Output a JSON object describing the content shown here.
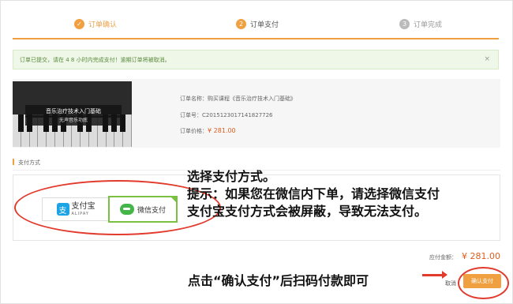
{
  "steps": [
    {
      "num": "✓",
      "label": "订单确认"
    },
    {
      "num": "2",
      "label": "订单支付"
    },
    {
      "num": "3",
      "label": "订单完成"
    }
  ],
  "alert": {
    "text": "订单已提交，请在 4 8 小时内完成支付！逾期订单将被取消。",
    "close": "×"
  },
  "order": {
    "course_title": "音乐治疗技术入门基础",
    "course_subtitle": "无声音乐功底",
    "name": "订单名称：购买课程《音乐治疗技术入门基础》",
    "number": "订单号：C2015123017141827726",
    "price_label": "订单价格：",
    "price": "¥ 281.00"
  },
  "payment": {
    "section_label": "支付方式",
    "alipay_name": "支付宝",
    "alipay_sub": "ALIPAY",
    "wechat_name": "微信支付"
  },
  "notes": {
    "line1": "选择支付方式。",
    "line2": "提示：如果您在微信内下单，请选择微信支付",
    "line3": "支付宝支付方式会被屏蔽，导致无法支付。",
    "bottom": "点击“确认支付”后扫码付款即可"
  },
  "footer": {
    "amount_label": "应付金额：",
    "amount": "¥ 281.00",
    "cancel": "取消",
    "confirm": "确认支付"
  },
  "colors": {
    "accent": "#f0a040",
    "price": "#e05d1e",
    "annotation": "#e23a2c",
    "wechat": "#7ac143",
    "alipay": "#1aa3e5"
  }
}
